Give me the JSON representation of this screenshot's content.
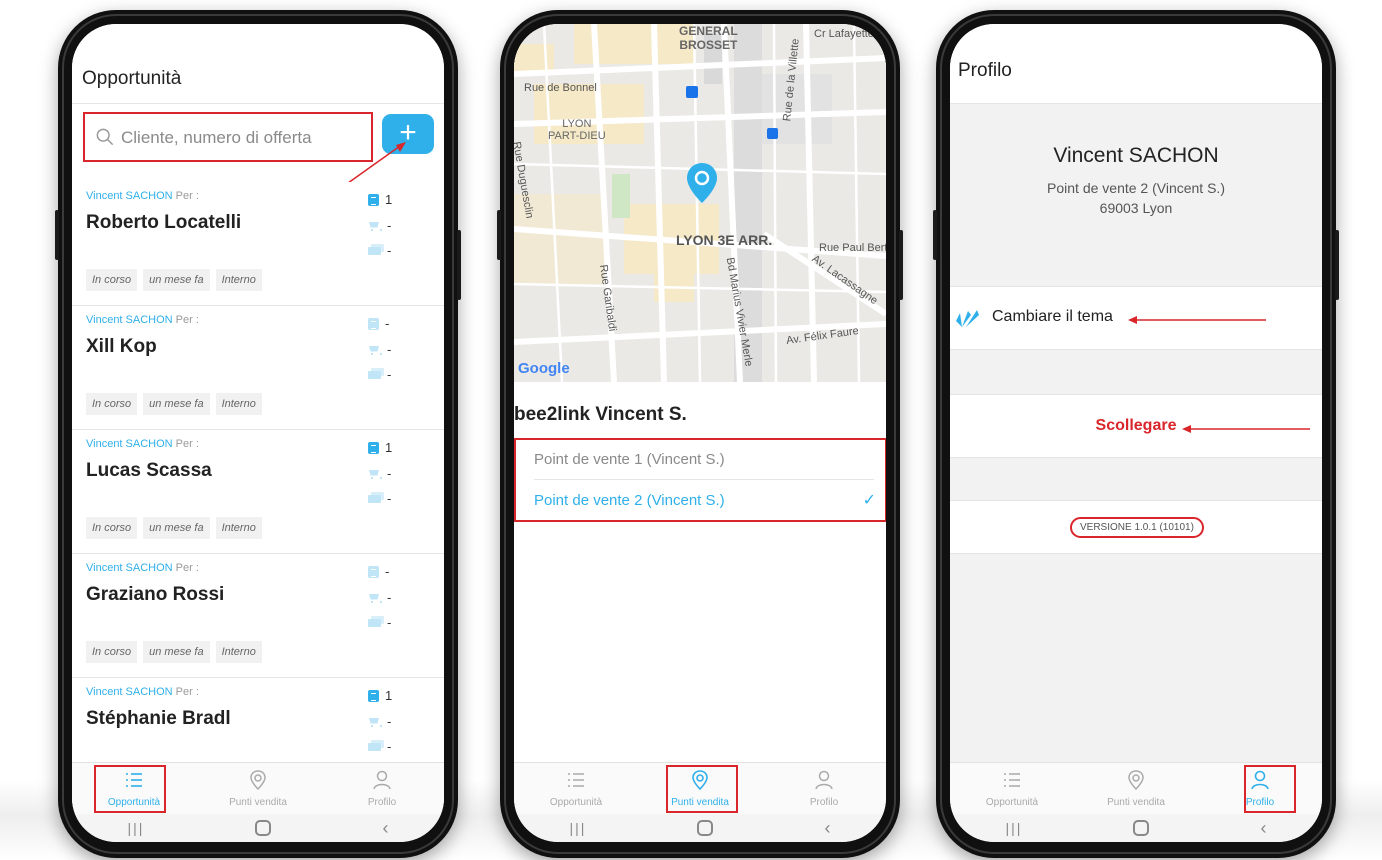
{
  "nav": {
    "opportunities": "Opportunità",
    "stores": "Punti vendita",
    "profile": "Profilo"
  },
  "screen1": {
    "title": "Opportunità",
    "search_placeholder": "Cliente, numero di offerta",
    "add_label": "+",
    "per_label": "Per :",
    "items": [
      {
        "owner": "Vincent SACHON",
        "name": "Roberto  Locatelli",
        "offers": "1",
        "orders": "-",
        "other": "-",
        "tags": [
          "In corso",
          "un mese fa",
          "Interno"
        ]
      },
      {
        "owner": "Vincent SACHON",
        "name": "Xill Kop",
        "offers": "-",
        "orders": "-",
        "other": "-",
        "tags": [
          "In corso",
          "un mese fa",
          "Interno"
        ]
      },
      {
        "owner": "Vincent SACHON",
        "name": "Lucas Scassa",
        "offers": "1",
        "orders": "-",
        "other": "-",
        "tags": [
          "In corso",
          "un mese fa",
          "Interno"
        ]
      },
      {
        "owner": "Vincent SACHON",
        "name": "Graziano Rossi",
        "offers": "-",
        "orders": "-",
        "other": "-",
        "tags": [
          "In corso",
          "un mese fa",
          "Interno"
        ]
      },
      {
        "owner": "Vincent SACHON",
        "name": "Stéphanie  Bradl",
        "offers": "1",
        "orders": "-",
        "other": "-",
        "tags": [
          "In corso",
          "un mese fa",
          "Interno"
        ]
      }
    ]
  },
  "screen2": {
    "map_labels": {
      "general_brosset": "GENERAL\nBROSSET",
      "cr_lafayette": "Cr Lafayette",
      "rue_bonnel": "Rue de Bonnel",
      "lyon_part_dieu": "LYON\nPART-DIEU",
      "rue_duguesclin": "Rue Duguesclin",
      "rue_villette": "Rue de la Villette",
      "lyon_3e": "LYON 3E ARR.",
      "rue_paul_bert": "Rue Paul Bert",
      "av_lacassagne": "Av. Lacassagne",
      "rue_garibaldi": "Rue Garibaldi",
      "bd_vivier_merle": "Bd Marius Vivier Merle",
      "av_felix_faure": "Av. Félix Faure",
      "google": "Google"
    },
    "store_name": "bee2link Vincent S.",
    "points": [
      {
        "label": "Point de vente 1 (Vincent S.)",
        "selected": false
      },
      {
        "label": "Point de vente 2 (Vincent S.)",
        "selected": true
      }
    ],
    "check": "✓"
  },
  "screen3": {
    "title": "Profilo",
    "user_name": "Vincent SACHON",
    "point_of_sale": "Point de vente 2 (Vincent S.)",
    "city": "69003 Lyon",
    "change_theme": "Cambiare il tema",
    "logout": "Scollegare",
    "version": "VERSIONE 1.0.1 (10101)"
  },
  "colors": {
    "accent": "#2fb0ea",
    "annotation": "#d9262b"
  }
}
